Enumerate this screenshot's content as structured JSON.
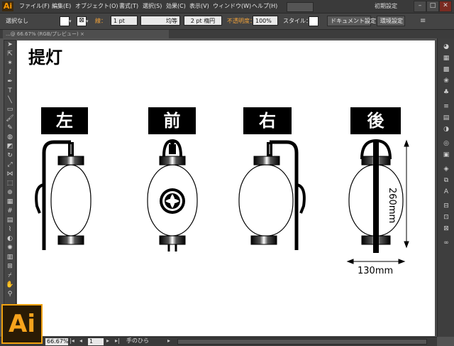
{
  "app": {
    "logo": "Ai"
  },
  "menu": {
    "items": [
      "ファイル(F)",
      "編集(E)",
      "オブジェクト(O)",
      "書式(T)",
      "選択(S)",
      "効果(C)",
      "表示(V)",
      "ウィンドウ(W)",
      "ヘルプ(H)"
    ],
    "workspace": "初期設定"
  },
  "window_buttons": {
    "minimize": "–",
    "maximize": "□",
    "close": "✕"
  },
  "controlbar": {
    "selection_status": "選択なし",
    "stroke_label": "線：",
    "stroke_weight": "1 pt",
    "stroke_profile": "均等",
    "brush": "2 pt 楕円",
    "opacity_label": "不透明度：",
    "opacity_value": "100%",
    "style_label": "スタイル：",
    "doc_settings_button": "ドキュメント設定",
    "preferences_button": "環境設定"
  },
  "document_tab": {
    "label": "...@ 66.67% (RGB/プレビュー) ×"
  },
  "artboard": {
    "title": "提灯",
    "views": [
      {
        "label": "左"
      },
      {
        "label": "前"
      },
      {
        "label": "右"
      },
      {
        "label": "後"
      }
    ],
    "dimension_height": "260mm",
    "dimension_width": "130mm"
  },
  "statusbar": {
    "zoom": "66.67%",
    "page": "1",
    "tool_name": "手のひら"
  },
  "colors": {
    "chrome_dark": "#3a3a3a",
    "chrome_mid": "#535353",
    "accent_orange": "#f7a31c",
    "artboard": "#ffffff",
    "ink": "#000000"
  }
}
